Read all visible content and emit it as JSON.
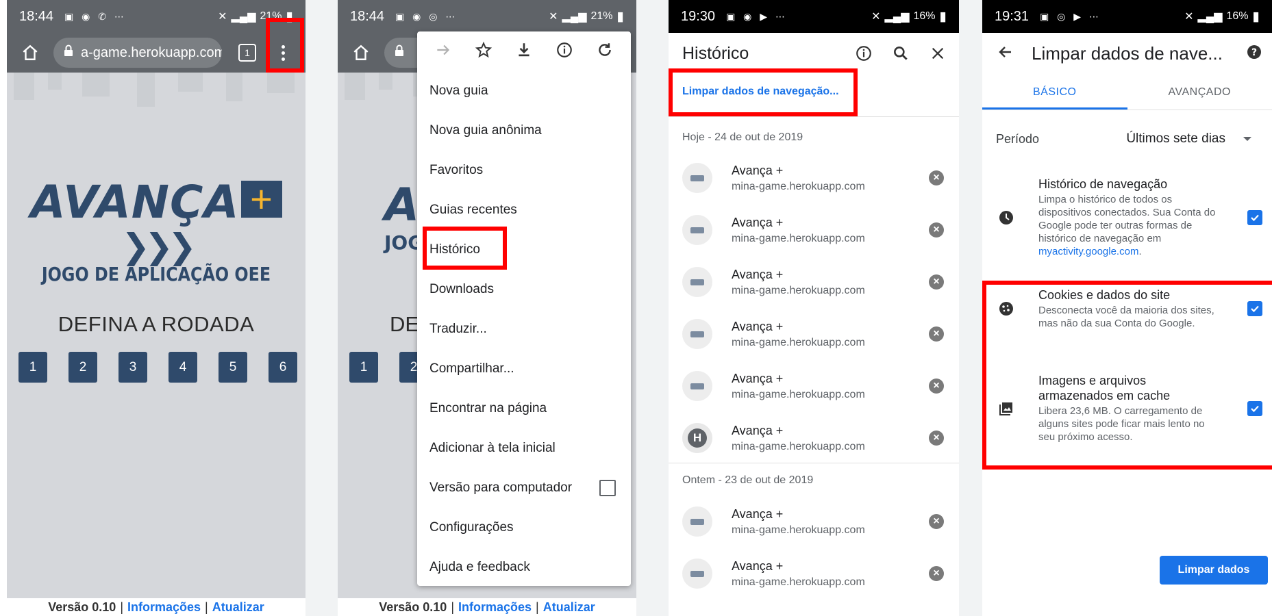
{
  "screen1": {
    "status": {
      "time": "18:44",
      "battery": "21%"
    },
    "url": "a-game.herokuapp.com",
    "tab_count": "1",
    "logo": {
      "word": "AVANÇA",
      "plus": "+",
      "sub": "JOGO DE APLICAÇÃO OEE"
    },
    "heading": "DEFINA A RODADA",
    "rounds": [
      "1",
      "2",
      "3",
      "4",
      "5",
      "6"
    ],
    "footer": {
      "version": "Versão 0.10",
      "sep": "|",
      "info": "Informações",
      "update": "Atualizar"
    }
  },
  "screen2": {
    "status": {
      "time": "18:44",
      "battery": "21%"
    },
    "logo_partial": "A",
    "logo_sub_partial": "JOG",
    "heading_partial": "DE",
    "rounds_partial": [
      "1",
      "2"
    ],
    "menu": {
      "items": [
        "Nova guia",
        "Nova guia anônima",
        "Favoritos",
        "Guias recentes",
        "Histórico",
        "Downloads",
        "Traduzir...",
        "Compartilhar...",
        "Encontrar na página",
        "Adicionar à tela inicial",
        "Versão para computador",
        "Configurações",
        "Ajuda e feedback"
      ]
    },
    "footer": {
      "version": "Versão 0.10",
      "sep": "|",
      "info": "Informações",
      "update": "Atualizar"
    }
  },
  "screen3": {
    "status": {
      "time": "19:30",
      "battery": "16%"
    },
    "title": "Histórico",
    "clear_link": "Limpar dados de navegação...",
    "today": "Hoje - 24 de out de 2019",
    "yesterday": "Ontem - 23 de out de 2019",
    "entries_today": [
      {
        "title": "Avança +",
        "url": "mina-game.herokuapp.com",
        "icon": "site"
      },
      {
        "title": "Avança +",
        "url": "mina-game.herokuapp.com",
        "icon": "site"
      },
      {
        "title": "Avança +",
        "url": "mina-game.herokuapp.com",
        "icon": "site"
      },
      {
        "title": "Avança +",
        "url": "mina-game.herokuapp.com",
        "icon": "site"
      },
      {
        "title": "Avança +",
        "url": "mina-game.herokuapp.com",
        "icon": "site"
      },
      {
        "title": "Avança +",
        "url": "mina-game.herokuapp.com",
        "icon": "letter",
        "letter": "H"
      }
    ],
    "entries_yesterday": [
      {
        "title": "Avança +",
        "url": "mina-game.herokuapp.com"
      },
      {
        "title": "Avança +",
        "url": "mina-game.herokuapp.com"
      }
    ]
  },
  "screen4": {
    "status": {
      "time": "19:31",
      "battery": "16%"
    },
    "title": "Limpar dados de nave...",
    "tabs": [
      "BÁSICO",
      "AVANÇADO"
    ],
    "period_label": "Período",
    "period_value": "Últimos sete dias",
    "options": [
      {
        "title": "Histórico de navegação",
        "desc": "Limpa o histórico de todos os dispositivos conectados. Sua Conta do Google pode ter outras formas de histórico de navegação em",
        "link": "myactivity.google.com",
        "after": "."
      },
      {
        "title": "Cookies e dados do site",
        "desc": "Desconecta você da maioria dos sites, mas não da sua Conta do Google."
      },
      {
        "title": "Imagens e arquivos armazenados em cache",
        "desc": "Libera 23,6 MB. O carregamento de alguns sites pode ficar mais lento no seu próximo acesso."
      }
    ],
    "button": "Limpar dados"
  },
  "colors": {
    "accent": "#1a73e8",
    "highlight": "#ff0000",
    "brand_navy": "#2f4a6b",
    "brand_orange": "#f6b52e"
  }
}
